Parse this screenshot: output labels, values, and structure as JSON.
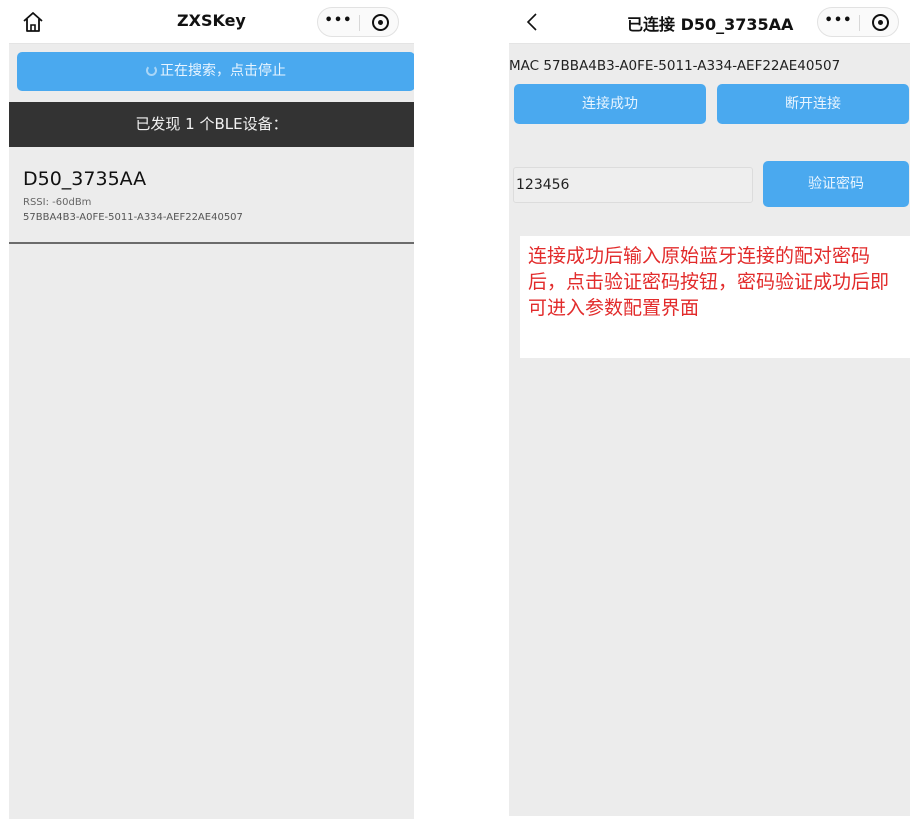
{
  "left_screen": {
    "nav": {
      "title": "ZXSKey",
      "home_icon": "home-icon",
      "more_icon": "more-dots-icon",
      "close_icon": "target-icon"
    },
    "search_button": {
      "label": "正在搜索，点击停止"
    },
    "found_bar": {
      "text": "已发现 1 个BLE设备："
    },
    "device": {
      "name": "D50_3735AA",
      "rssi": "RSSI: -60dBm",
      "uuid": "57BBA4B3-A0FE-5011-A334-AEF22AE40507"
    }
  },
  "right_screen": {
    "nav": {
      "back_icon": "back-chevron-icon",
      "title": "已连接 D50_3735AA",
      "more_icon": "more-dots-icon",
      "close_icon": "target-icon"
    },
    "mac": "MAC 57BBA4B3-A0FE-5011-A334-AEF22AE40507",
    "connect_status_button": "连接成功",
    "disconnect_button": "断开连接",
    "password_value": "123456",
    "verify_button": "验证密码",
    "note": "连接成功后输入原始蓝牙连接的配对密码后，点击验证密码按钮，密码验证成功后即可进入参数配置界面"
  },
  "colors": {
    "accent_blue": "#4aa9ef",
    "dark_bar": "#333333",
    "note_red": "#e22b2b",
    "page_bg": "#ececec"
  }
}
